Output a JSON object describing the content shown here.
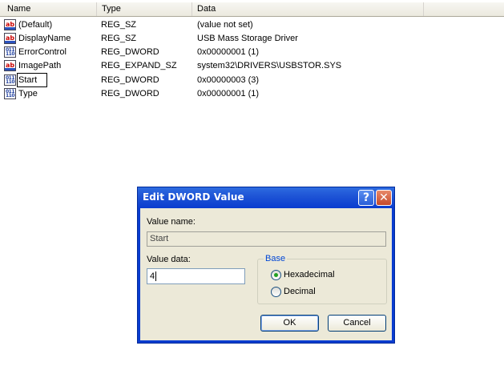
{
  "list": {
    "columns": {
      "name": "Name",
      "type": "Type",
      "data": "Data"
    },
    "rows": [
      {
        "icon": "string-value-icon",
        "name": "(Default)",
        "type": "REG_SZ",
        "data": "(value not set)"
      },
      {
        "icon": "string-value-icon",
        "name": "DisplayName",
        "type": "REG_SZ",
        "data": "USB Mass Storage Driver"
      },
      {
        "icon": "binary-value-icon",
        "name": "ErrorControl",
        "type": "REG_DWORD",
        "data": "0x00000001 (1)"
      },
      {
        "icon": "string-value-icon",
        "name": "ImagePath",
        "type": "REG_EXPAND_SZ",
        "data": "system32\\DRIVERS\\USBSTOR.SYS"
      },
      {
        "icon": "binary-value-icon",
        "name": "Start",
        "type": "REG_DWORD",
        "data": "0x00000003 (3)"
      },
      {
        "icon": "binary-value-icon",
        "name": "Type",
        "type": "REG_DWORD",
        "data": "0x00000001 (1)"
      }
    ],
    "selected_row": "Start"
  },
  "dialog": {
    "title": "Edit DWORD Value",
    "help_glyph": "?",
    "close_glyph": "✕",
    "value_name_label": "Value name:",
    "value_name": "Start",
    "value_data_label": "Value data:",
    "value_data": "4",
    "base_label": "Base",
    "base_options": [
      "Hexadecimal",
      "Decimal"
    ],
    "base_selected": "Hexadecimal",
    "ok_label": "OK",
    "cancel_label": "Cancel"
  },
  "colors": {
    "titlebar_blue": "#0a3ccf",
    "dialog_face": "#ece9d8",
    "group_title_blue": "#0046d5",
    "radio_selected_green": "#21a121",
    "close_button_red": "#c64a2a"
  }
}
